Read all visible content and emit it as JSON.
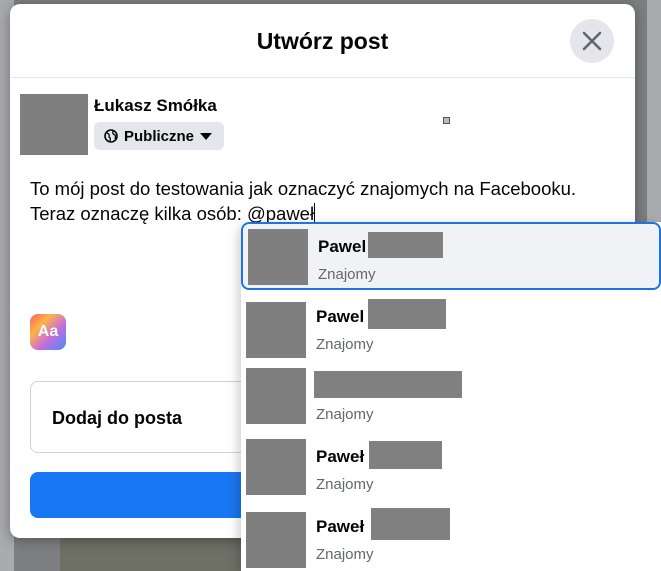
{
  "modal": {
    "title": "Utwórz post"
  },
  "user": {
    "name": "Łukasz Smółka",
    "privacy_label": "Publiczne"
  },
  "post": {
    "line1": "To mój post do testowania jak oznaczyć znajomych na Facebooku.",
    "line2": "Teraz oznaczę kilka osób: @paweł"
  },
  "composer": {
    "text_format_label": "Aa",
    "add_to_post_label": "Dodaj do posta"
  },
  "suggestions": [
    {
      "name": "Pawel",
      "status": "Znajomy"
    },
    {
      "name": "Pawel",
      "status": "Znajomy"
    },
    {
      "name": "",
      "status": "Znajomy"
    },
    {
      "name": "Paweł",
      "status": "Znajomy"
    },
    {
      "name": "Paweł",
      "status": "Znajomy"
    }
  ],
  "icons": {
    "close": "close-icon",
    "globe": "globe-icon",
    "caret": "caret-down-icon"
  },
  "colors": {
    "accent": "#1877f2",
    "selected_border": "#1b74e4"
  }
}
